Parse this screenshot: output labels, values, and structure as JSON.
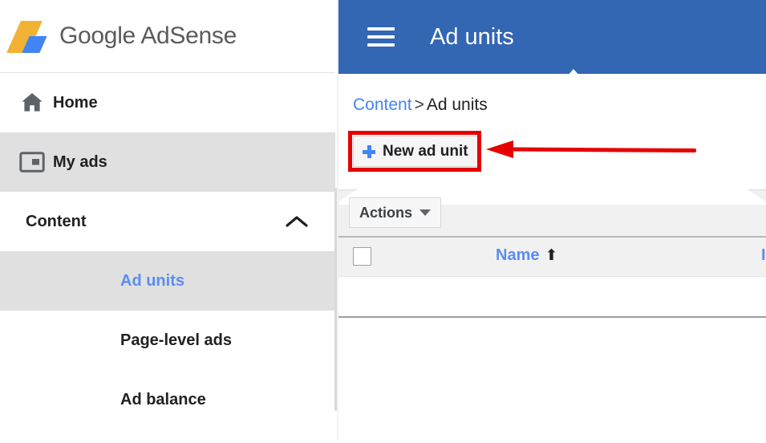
{
  "brand": {
    "name": "Google AdSense",
    "logo_icon": "adsense-logo-icon",
    "logo_yellow": "#F2B233",
    "logo_blue": "#4285F4"
  },
  "sidebar": {
    "items": [
      {
        "label": "Home",
        "icon": "home-icon",
        "level": "top",
        "selected": false
      },
      {
        "label": "My ads",
        "icon": "display-ad-icon",
        "level": "top",
        "selected": true
      },
      {
        "label": "Content",
        "icon": "chevron-up-icon",
        "level": "group",
        "selected": false,
        "expanded": true
      },
      {
        "label": "Ad units",
        "icon": "",
        "level": "sub",
        "selected": true
      },
      {
        "label": "Page-level ads",
        "icon": "",
        "level": "sub",
        "selected": false
      },
      {
        "label": "Ad balance",
        "icon": "",
        "level": "sub",
        "selected": false
      }
    ],
    "selected_color": "#5b8def",
    "highlight_bg": "#e0e0e0"
  },
  "topbar": {
    "menu_icon": "hamburger-menu-icon",
    "title": "Ad units",
    "background": "#3366B3"
  },
  "breadcrumb": {
    "parent": "Content",
    "separator": ">",
    "current": "Ad units",
    "link_color": "#4285F4"
  },
  "toolbar": {
    "new_ad_unit_label": "New ad unit",
    "new_ad_unit_icon": "plus-icon",
    "actions_label": "Actions",
    "actions_caret_icon": "caret-down-icon"
  },
  "table": {
    "select_all_checkbox": "select-all-checkbox",
    "columns": [
      {
        "label": "Name",
        "sorted": true,
        "sort_direction": "ascending",
        "sort_icon": "arrow-up-icon"
      },
      {
        "label": "ID",
        "sorted": false
      }
    ],
    "rows": [],
    "header_color": "#5b8def"
  },
  "annotations": {
    "highlight_box_color": "#E60000",
    "arrow_color": "#E60000",
    "arrow_direction": "left",
    "target": "New ad unit"
  }
}
